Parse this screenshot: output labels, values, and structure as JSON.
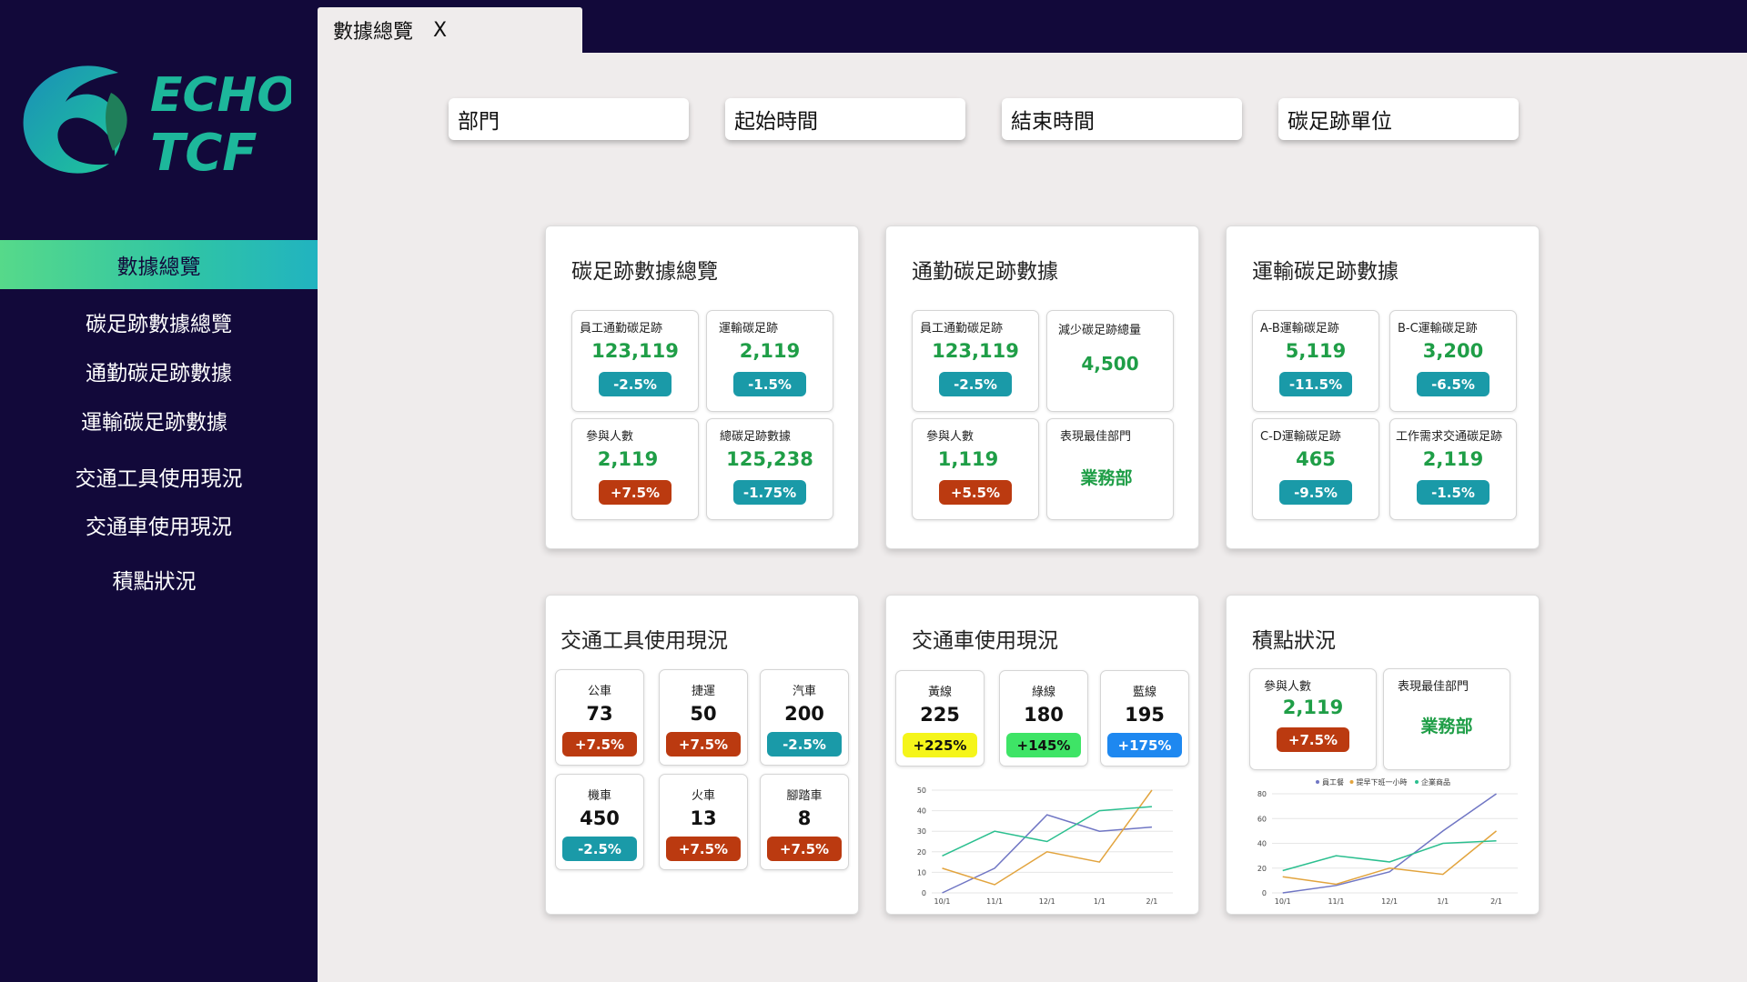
{
  "brand": {
    "line1": "ECHO",
    "line2": "TCF"
  },
  "tab": {
    "title": "數據總覽",
    "close": "X"
  },
  "sidebar": {
    "active": "數據總覽",
    "items": [
      "碳足跡數據總覽",
      "通勤碳足跡數據",
      "運輸碳足跡數據",
      "交通工具使用現況",
      "交通車使用現況",
      "積點狀況"
    ]
  },
  "filters": [
    "部門",
    "起始時間",
    "結束時間",
    "碳足跡單位"
  ],
  "panels": {
    "overview": {
      "title": "碳足跡數據總覽",
      "stats": [
        {
          "label": "員工通勤碳足跡",
          "value": "123,119",
          "change": "-2.5%",
          "tone": "teal"
        },
        {
          "label": "運輸碳足跡",
          "value": "2,119",
          "change": "-1.5%",
          "tone": "teal"
        },
        {
          "label": "參與人數",
          "value": "2,119",
          "change": "+7.5%",
          "tone": "red"
        },
        {
          "label": "總碳足跡數據",
          "value": "125,238",
          "change": "-1.75%",
          "tone": "teal"
        }
      ]
    },
    "commute": {
      "title": "通勤碳足跡數據",
      "stats": [
        {
          "label": "員工通勤碳足跡",
          "value": "123,119",
          "change": "-2.5%",
          "tone": "teal"
        },
        {
          "label": "減少碳足跡總量",
          "value": "4,500"
        },
        {
          "label": "參與人數",
          "value": "1,119",
          "change": "+5.5%",
          "tone": "red"
        },
        {
          "label": "表現最佳部門",
          "value": "業務部"
        }
      ]
    },
    "transport": {
      "title": "運輸碳足跡數據",
      "stats": [
        {
          "label": "A-B運輸碳足跡",
          "value": "5,119",
          "change": "-11.5%",
          "tone": "teal"
        },
        {
          "label": "B-C運輸碳足跡",
          "value": "3,200",
          "change": "-6.5%",
          "tone": "teal"
        },
        {
          "label": "C-D運輸碳足跡",
          "value": "465",
          "change": "-9.5%",
          "tone": "teal"
        },
        {
          "label": "工作需求交通碳足跡",
          "value": "2,119",
          "change": "-1.5%",
          "tone": "teal"
        }
      ]
    },
    "vehicles": {
      "title": "交通工具使用現況",
      "stats": [
        {
          "label": "公車",
          "value": "73",
          "change": "+7.5%",
          "tone": "red"
        },
        {
          "label": "捷運",
          "value": "50",
          "change": "+7.5%",
          "tone": "red"
        },
        {
          "label": "汽車",
          "value": "200",
          "change": "-2.5%",
          "tone": "teal"
        },
        {
          "label": "機車",
          "value": "450",
          "change": "-2.5%",
          "tone": "teal"
        },
        {
          "label": "火車",
          "value": "13",
          "change": "+7.5%",
          "tone": "red"
        },
        {
          "label": "腳踏車",
          "value": "8",
          "change": "+7.5%",
          "tone": "red"
        }
      ]
    },
    "shuttle": {
      "title": "交通車使用現況",
      "stats": [
        {
          "label": "黃線",
          "value": "225",
          "change": "+225%",
          "tone": "yellow"
        },
        {
          "label": "綠線",
          "value": "180",
          "change": "+145%",
          "tone": "green"
        },
        {
          "label": "藍線",
          "value": "195",
          "change": "+175%",
          "tone": "blue"
        }
      ]
    },
    "points": {
      "title": "積點狀況",
      "stats": [
        {
          "label": "參與人數",
          "value": "2,119",
          "change": "+7.5%",
          "tone": "red"
        },
        {
          "label": "表現最佳部門",
          "value": "業務部"
        }
      ]
    }
  },
  "colors": {
    "sidebar": "#12093a",
    "accent_green": "#1f9e47",
    "teal": "#1a9aa8",
    "red": "#bb3a10"
  },
  "chart_data": [
    {
      "type": "line",
      "categories": [
        "10/1",
        "11/1",
        "12/1",
        "1/1",
        "2/1"
      ],
      "ylim": [
        0,
        50
      ],
      "yticks": [
        0,
        10,
        20,
        30,
        40,
        50
      ],
      "grid": true,
      "series": [
        {
          "color": "#7076c4",
          "values": [
            0,
            12,
            38,
            30,
            32
          ]
        },
        {
          "color": "#e2a43e",
          "values": [
            12,
            4,
            20,
            15,
            50
          ]
        },
        {
          "color": "#2bbf8f",
          "values": [
            18,
            30,
            25,
            40,
            42
          ]
        }
      ]
    },
    {
      "type": "line",
      "categories": [
        "10/1",
        "11/1",
        "12/1",
        "1/1",
        "2/1"
      ],
      "ylim": [
        0,
        80
      ],
      "yticks": [
        0,
        20,
        40,
        60,
        80
      ],
      "grid": true,
      "legend": [
        "員工餐",
        "提早下班一小時",
        "企業商品"
      ],
      "legend_position": "top",
      "series": [
        {
          "name": "員工餐",
          "color": "#7076c4",
          "values": [
            0,
            6,
            17,
            50,
            80
          ]
        },
        {
          "name": "提早下班一小時",
          "color": "#e2a43e",
          "values": [
            13,
            7,
            20,
            15,
            50
          ]
        },
        {
          "name": "企業商品",
          "color": "#2bbf8f",
          "values": [
            18,
            30,
            25,
            40,
            42
          ]
        }
      ]
    }
  ]
}
